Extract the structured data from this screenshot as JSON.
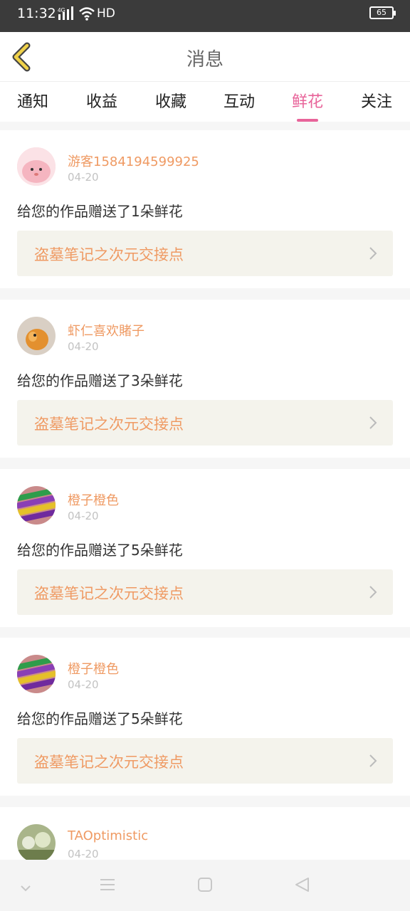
{
  "status": {
    "time": "11:32",
    "network_label": "4G",
    "hd": "HD",
    "battery": "65"
  },
  "header": {
    "title": "消息"
  },
  "tabs": [
    {
      "label": "通知"
    },
    {
      "label": "收益"
    },
    {
      "label": "收藏"
    },
    {
      "label": "互动"
    },
    {
      "label": "鲜花",
      "active": true
    },
    {
      "label": "关注"
    }
  ],
  "notifications": [
    {
      "username": "游客1584194599925",
      "date": "04-20",
      "message": "给您的作品赠送了1朵鲜花",
      "work_title": "盗墓笔记之次元交接点"
    },
    {
      "username": "虾仁喜欢賭子",
      "date": "04-20",
      "message": "给您的作品赠送了3朵鲜花",
      "work_title": "盗墓笔记之次元交接点"
    },
    {
      "username": "橙子橙色",
      "date": "04-20",
      "message": "给您的作品赠送了5朵鲜花",
      "work_title": "盗墓笔记之次元交接点"
    },
    {
      "username": "橙子橙色",
      "date": "04-20",
      "message": "给您的作品赠送了5朵鲜花",
      "work_title": "盗墓笔记之次元交接点"
    },
    {
      "username": "TAOptimistic",
      "date": "04-20",
      "message": "",
      "work_title": ""
    }
  ],
  "colors": {
    "accent": "#e8649a",
    "name": "#ef9a63",
    "back": "#f0d24a"
  }
}
